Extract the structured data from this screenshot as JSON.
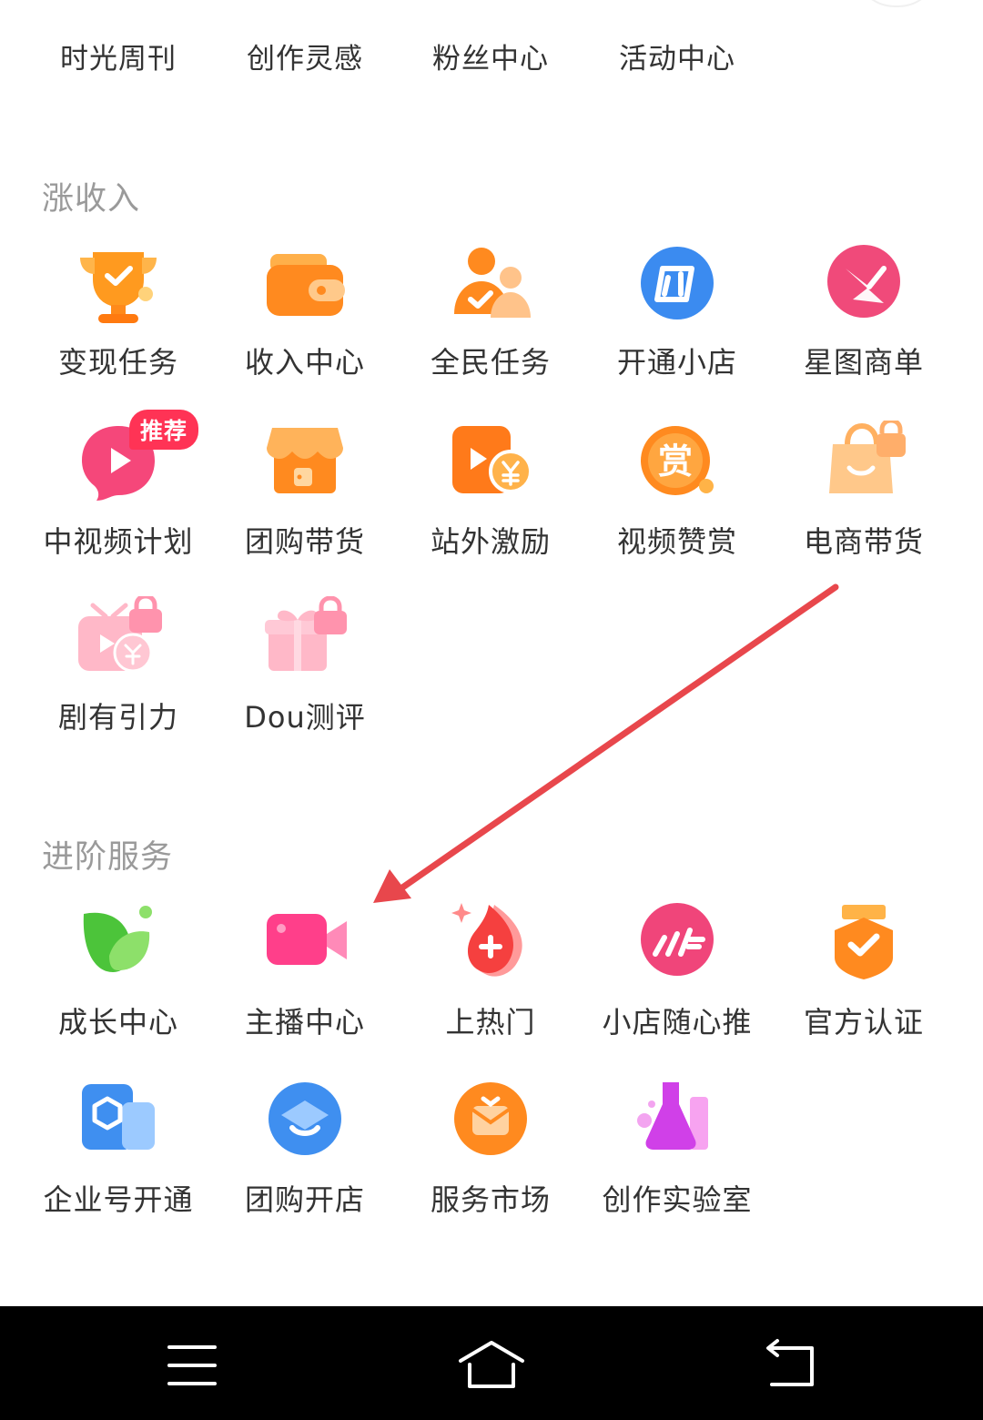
{
  "top_links": [
    "时光周刊",
    "创作灵感",
    "粉丝中心",
    "活动中心"
  ],
  "sections": {
    "income": {
      "title": "涨收入",
      "items": [
        {
          "label": "变现任务",
          "icon": "trophy-icon"
        },
        {
          "label": "收入中心",
          "icon": "wallet-icon"
        },
        {
          "label": "全民任务",
          "icon": "people-check-icon"
        },
        {
          "label": "开通小店",
          "icon": "shop-logo-icon"
        },
        {
          "label": "星图商单",
          "icon": "star-map-icon"
        },
        {
          "label": "中视频计划",
          "icon": "play-bubble-icon",
          "badge": "推荐"
        },
        {
          "label": "团购带货",
          "icon": "storefront-icon"
        },
        {
          "label": "站外激励",
          "icon": "video-coin-icon"
        },
        {
          "label": "视频赞赏",
          "icon": "reward-coin-icon"
        },
        {
          "label": "电商带货",
          "icon": "locked-bag-icon"
        },
        {
          "label": "剧有引力",
          "icon": "locked-tv-coin-icon"
        },
        {
          "label": "Dou测评",
          "icon": "locked-gift-icon"
        }
      ]
    },
    "advanced": {
      "title": "进阶服务",
      "items": [
        {
          "label": "成长中心",
          "icon": "leaf-icon"
        },
        {
          "label": "主播中心",
          "icon": "video-camera-icon"
        },
        {
          "label": "上热门",
          "icon": "flame-plus-icon"
        },
        {
          "label": "小店随心推",
          "icon": "boost-icon"
        },
        {
          "label": "官方认证",
          "icon": "verified-badge-icon"
        },
        {
          "label": "企业号开通",
          "icon": "enterprise-icon"
        },
        {
          "label": "团购开店",
          "icon": "group-buy-store-icon"
        },
        {
          "label": "服务市场",
          "icon": "service-market-icon"
        },
        {
          "label": "创作实验室",
          "icon": "lab-flask-icon"
        }
      ]
    }
  },
  "colors": {
    "arrow": "#e8474c",
    "badge": "#ff3355",
    "section_title": "#9a9a9a"
  },
  "nav": [
    "menu-icon",
    "home-icon",
    "back-icon"
  ]
}
